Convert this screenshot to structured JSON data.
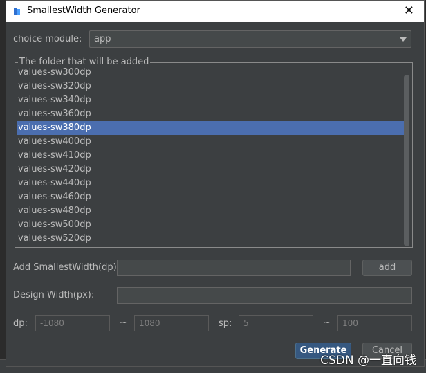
{
  "window": {
    "title": "SmallestWidth Generator"
  },
  "module": {
    "label": "choice module:",
    "value": "app"
  },
  "folder_group": {
    "legend": "The folder that will be added",
    "items": [
      "values-sw300dp",
      "values-sw320dp",
      "values-sw340dp",
      "values-sw360dp",
      "values-sw380dp",
      "values-sw400dp",
      "values-sw410dp",
      "values-sw420dp",
      "values-sw440dp",
      "values-sw460dp",
      "values-sw480dp",
      "values-sw500dp",
      "values-sw520dp"
    ],
    "selected": "values-sw380dp"
  },
  "add_row": {
    "label": "Add SmallestWidth(dp):",
    "value": "",
    "button": "add"
  },
  "design_row": {
    "label": "Design Width(px):",
    "value": ""
  },
  "range_row": {
    "dp_label": "dp:",
    "dp_min": "-1080",
    "dp_max": "1080",
    "sp_label": "sp:",
    "sp_min": "5",
    "sp_max": "100",
    "tilde": "~"
  },
  "footer": {
    "generate": "Generate",
    "cancel": "Cancel"
  },
  "watermark": "CSDN @一直向钱",
  "colors": {
    "selection": "#4b6eaf",
    "primary_button": "#365880",
    "dialog_bg": "#3c3f41"
  },
  "icons": {
    "app": "plugin-icon",
    "close": "close-icon",
    "dropdown": "chevron-down-icon"
  }
}
